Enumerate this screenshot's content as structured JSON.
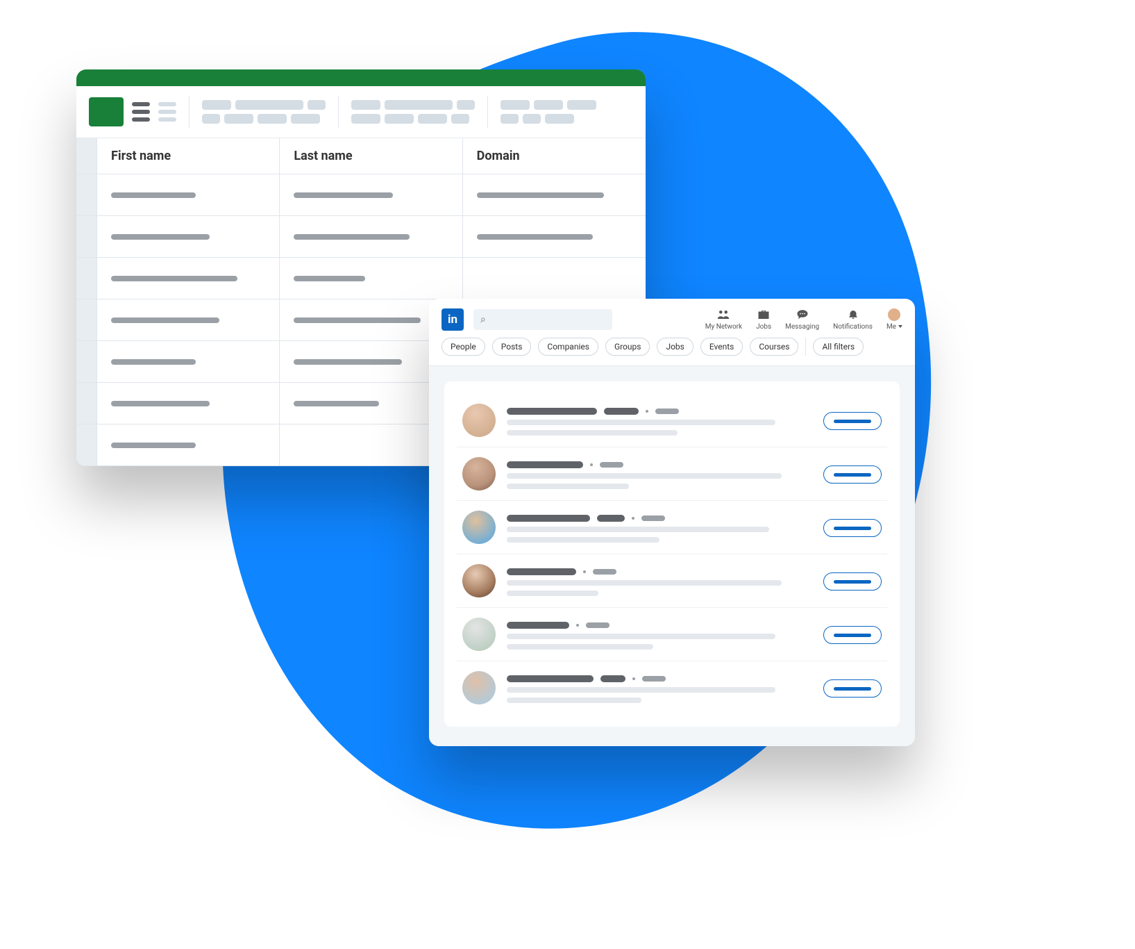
{
  "spreadsheet": {
    "columns": [
      "First name",
      "Last name",
      "Domain"
    ]
  },
  "social": {
    "logo_text": "in",
    "search_icon": "⌕",
    "nav": {
      "network": "My Network",
      "jobs": "Jobs",
      "messaging": "Messaging",
      "notifications": "Notifications",
      "me": "Me"
    },
    "filters": [
      "People",
      "Posts",
      "Companies",
      "Groups",
      "Jobs",
      "Events",
      "Courses",
      "All filters"
    ]
  }
}
